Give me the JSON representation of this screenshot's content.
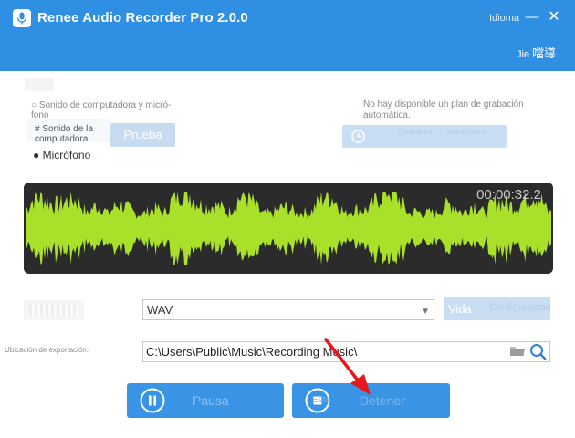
{
  "app": {
    "title": "Renee Audio Recorder Pro 2.0.0",
    "language_link": "Idioma",
    "minimize_glyph": "—",
    "close_glyph": "✕",
    "user_label": "Jie",
    "user_label_cjk": "噹導"
  },
  "source": {
    "computer_and_mic": "○ Sonido de computadora y micró-fono",
    "computer_sound": "# Sonido de la computadora",
    "microphone": "● Micrófono"
  },
  "test_button": {
    "label": "Prueba"
  },
  "schedule": {
    "note": "No hay disponible un plan de grabación automática.",
    "button_label": "Grabación ... automática"
  },
  "recording": {
    "timer": "00:00:32.2",
    "wave_color": "#a8e02a"
  },
  "format": {
    "selected": "WAV",
    "quality_button": "Vida",
    "settings_button": "Configuración"
  },
  "export": {
    "label": "Ubicación de exportación:",
    "path": "C:\\Users\\Public\\Music\\Recording Music\\"
  },
  "actions": {
    "pause_label": "Pausa",
    "stop_label": "Detener",
    "stop_sublabel": "Esto"
  },
  "colors": {
    "titlebar": "#2f8fe3",
    "action_button": "#3a94e6",
    "disabled_button": "#c9def3",
    "annotation_arrow": "#e8161b"
  }
}
